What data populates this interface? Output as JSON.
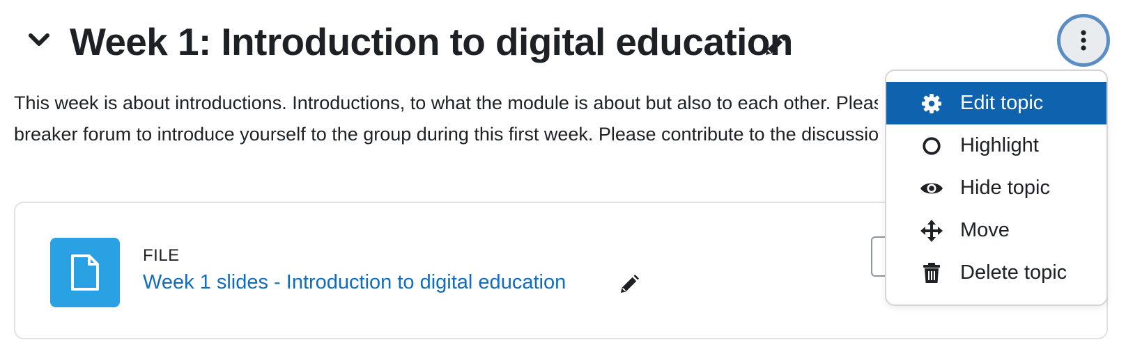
{
  "section": {
    "title": "Week 1: Introduction to digital education",
    "summary_lines": [
      "This week is about introductions. Introductions, to what the module is about but also to each other. Please use the ice",
      "breaker forum to introduce yourself to the group during this first week. Please contribute to the discussions."
    ]
  },
  "activity": {
    "type_label": "FILE",
    "name": "Week 1 slides - Introduction to digital education",
    "icon": "file-icon",
    "icon_bg": "#2aa1e2",
    "link_color": "#0f6cbf"
  },
  "menu": {
    "items": [
      {
        "label": "Edit topic",
        "icon": "gear-icon",
        "active": true
      },
      {
        "label": "Highlight",
        "icon": "circle-icon",
        "active": false
      },
      {
        "label": "Hide topic",
        "icon": "eye-icon",
        "active": false
      },
      {
        "label": "Move",
        "icon": "move-icon",
        "active": false
      },
      {
        "label": "Delete topic",
        "icon": "trash-icon",
        "active": false
      }
    ],
    "active_color": "#0f62ae"
  },
  "colors": {
    "text": "#1d2125",
    "kebab_bg": "#e9ecef",
    "kebab_focus_ring": "#5b8ec4",
    "card_border": "#dee2e6"
  }
}
